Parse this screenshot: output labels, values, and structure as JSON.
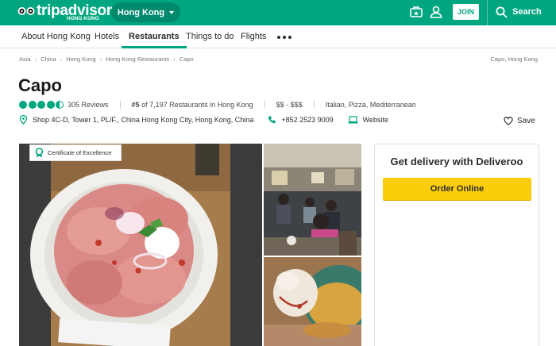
{
  "header": {
    "logo_text": "tripadvisor",
    "logo_sub": "HONG KONG",
    "location_label": "Hong Kong",
    "join_label": "JOIN",
    "search_label": "Search"
  },
  "nav": {
    "items": [
      "About Hong Kong",
      "Hotels",
      "Restaurants",
      "Things to do",
      "Flights"
    ],
    "active": "Restaurants"
  },
  "breadcrumb": {
    "items": [
      "Asia",
      "China",
      "Hong Kong",
      "Hong Kong Restaurants",
      "Capo"
    ],
    "right": "Capo, Hong Kong"
  },
  "restaurant": {
    "name": "Capo",
    "rating": 4.5,
    "reviews": "305 Reviews",
    "rank_num": "#5",
    "rank_text": "of 7,197 Restaurants in Hong Kong",
    "price": "$$ - $$$",
    "cuisines": "Italian, Pizza, Mediterranean",
    "address": "Shop 4C-D, Tower 1, PL/F., China Hong Kong City, Hong Kong, China",
    "phone": "+852 2523 9009",
    "website_label": "Website",
    "save_label": "Save"
  },
  "gallery": {
    "certificate_label": "Certificate of Excellence"
  },
  "delivery": {
    "title": "Get delivery with Deliveroo",
    "button_label": "Order Online"
  },
  "colors": {
    "brand": "#00a680",
    "order_button": "#fbcd0a"
  }
}
